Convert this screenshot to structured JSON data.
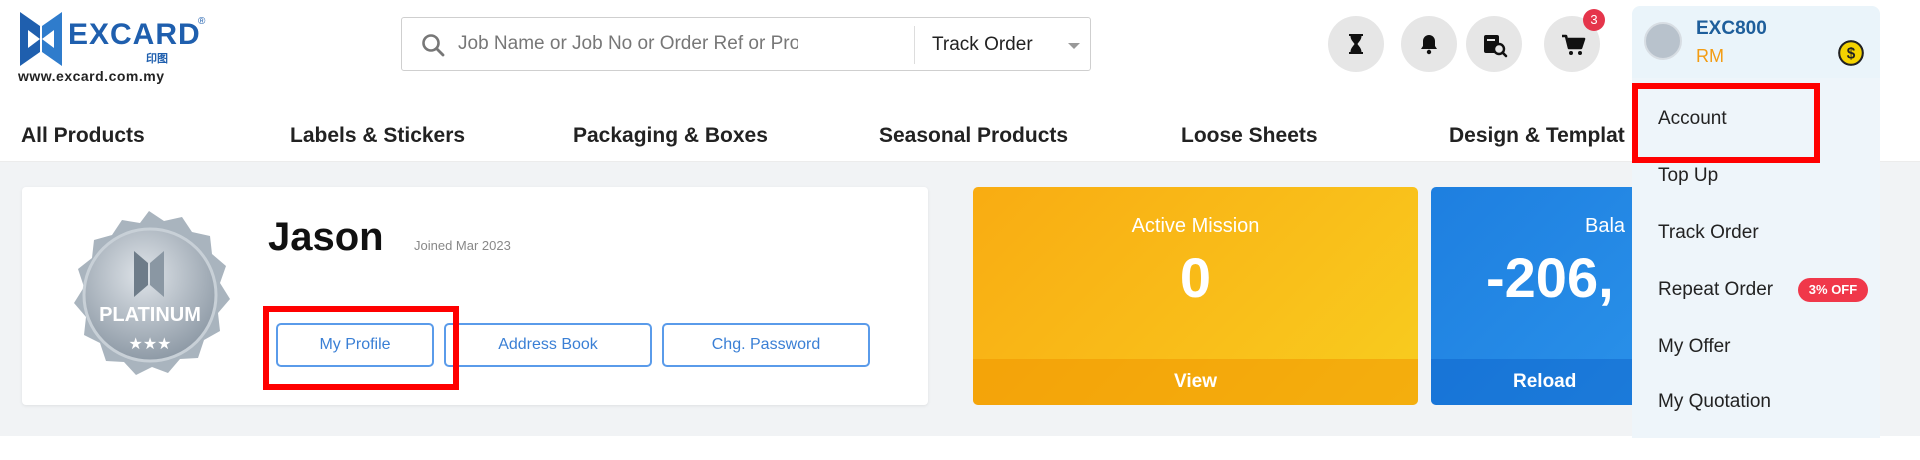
{
  "logo": {
    "brand": "EXCARD",
    "reg": "®",
    "cn": "印图",
    "url": "www.excard.com.my"
  },
  "search": {
    "placeholder": "Job Name or Job No or Order Ref or Product",
    "value": "",
    "track_label": "Track Order"
  },
  "header": {
    "cart_count": "3"
  },
  "account": {
    "id": "EXC800",
    "currency": "RM"
  },
  "nav": {
    "items": [
      {
        "label": "All Products"
      },
      {
        "label": "Labels & Stickers"
      },
      {
        "label": "Packaging & Boxes"
      },
      {
        "label": "Seasonal Products"
      },
      {
        "label": "Loose Sheets"
      },
      {
        "label": "Design & Templat"
      }
    ]
  },
  "profile": {
    "badge_text": "PLATINUM",
    "name": "Jason",
    "joined": "Joined Mar 2023",
    "buttons": {
      "my_profile": "My Profile",
      "address_book": "Address Book",
      "change_password": "Chg. Password"
    }
  },
  "tiles": {
    "mission": {
      "title": "Active Mission",
      "value": "0",
      "action": "View"
    },
    "balance": {
      "title": "Bala",
      "value": "-206,",
      "action": "Reload"
    }
  },
  "menu": {
    "items": [
      {
        "label": "Account"
      },
      {
        "label": "Top Up"
      },
      {
        "label": "Track Order"
      },
      {
        "label": "Repeat Order"
      },
      {
        "label": "My Offer"
      },
      {
        "label": "My Quotation"
      }
    ],
    "repeat_badge": "3% OFF"
  },
  "colors": {
    "accent": "#1f5fae",
    "highlight": "#ff0000",
    "mission_tile": "#f9b416",
    "balance_tile": "#2b8be6",
    "badge": "#f0384a"
  }
}
